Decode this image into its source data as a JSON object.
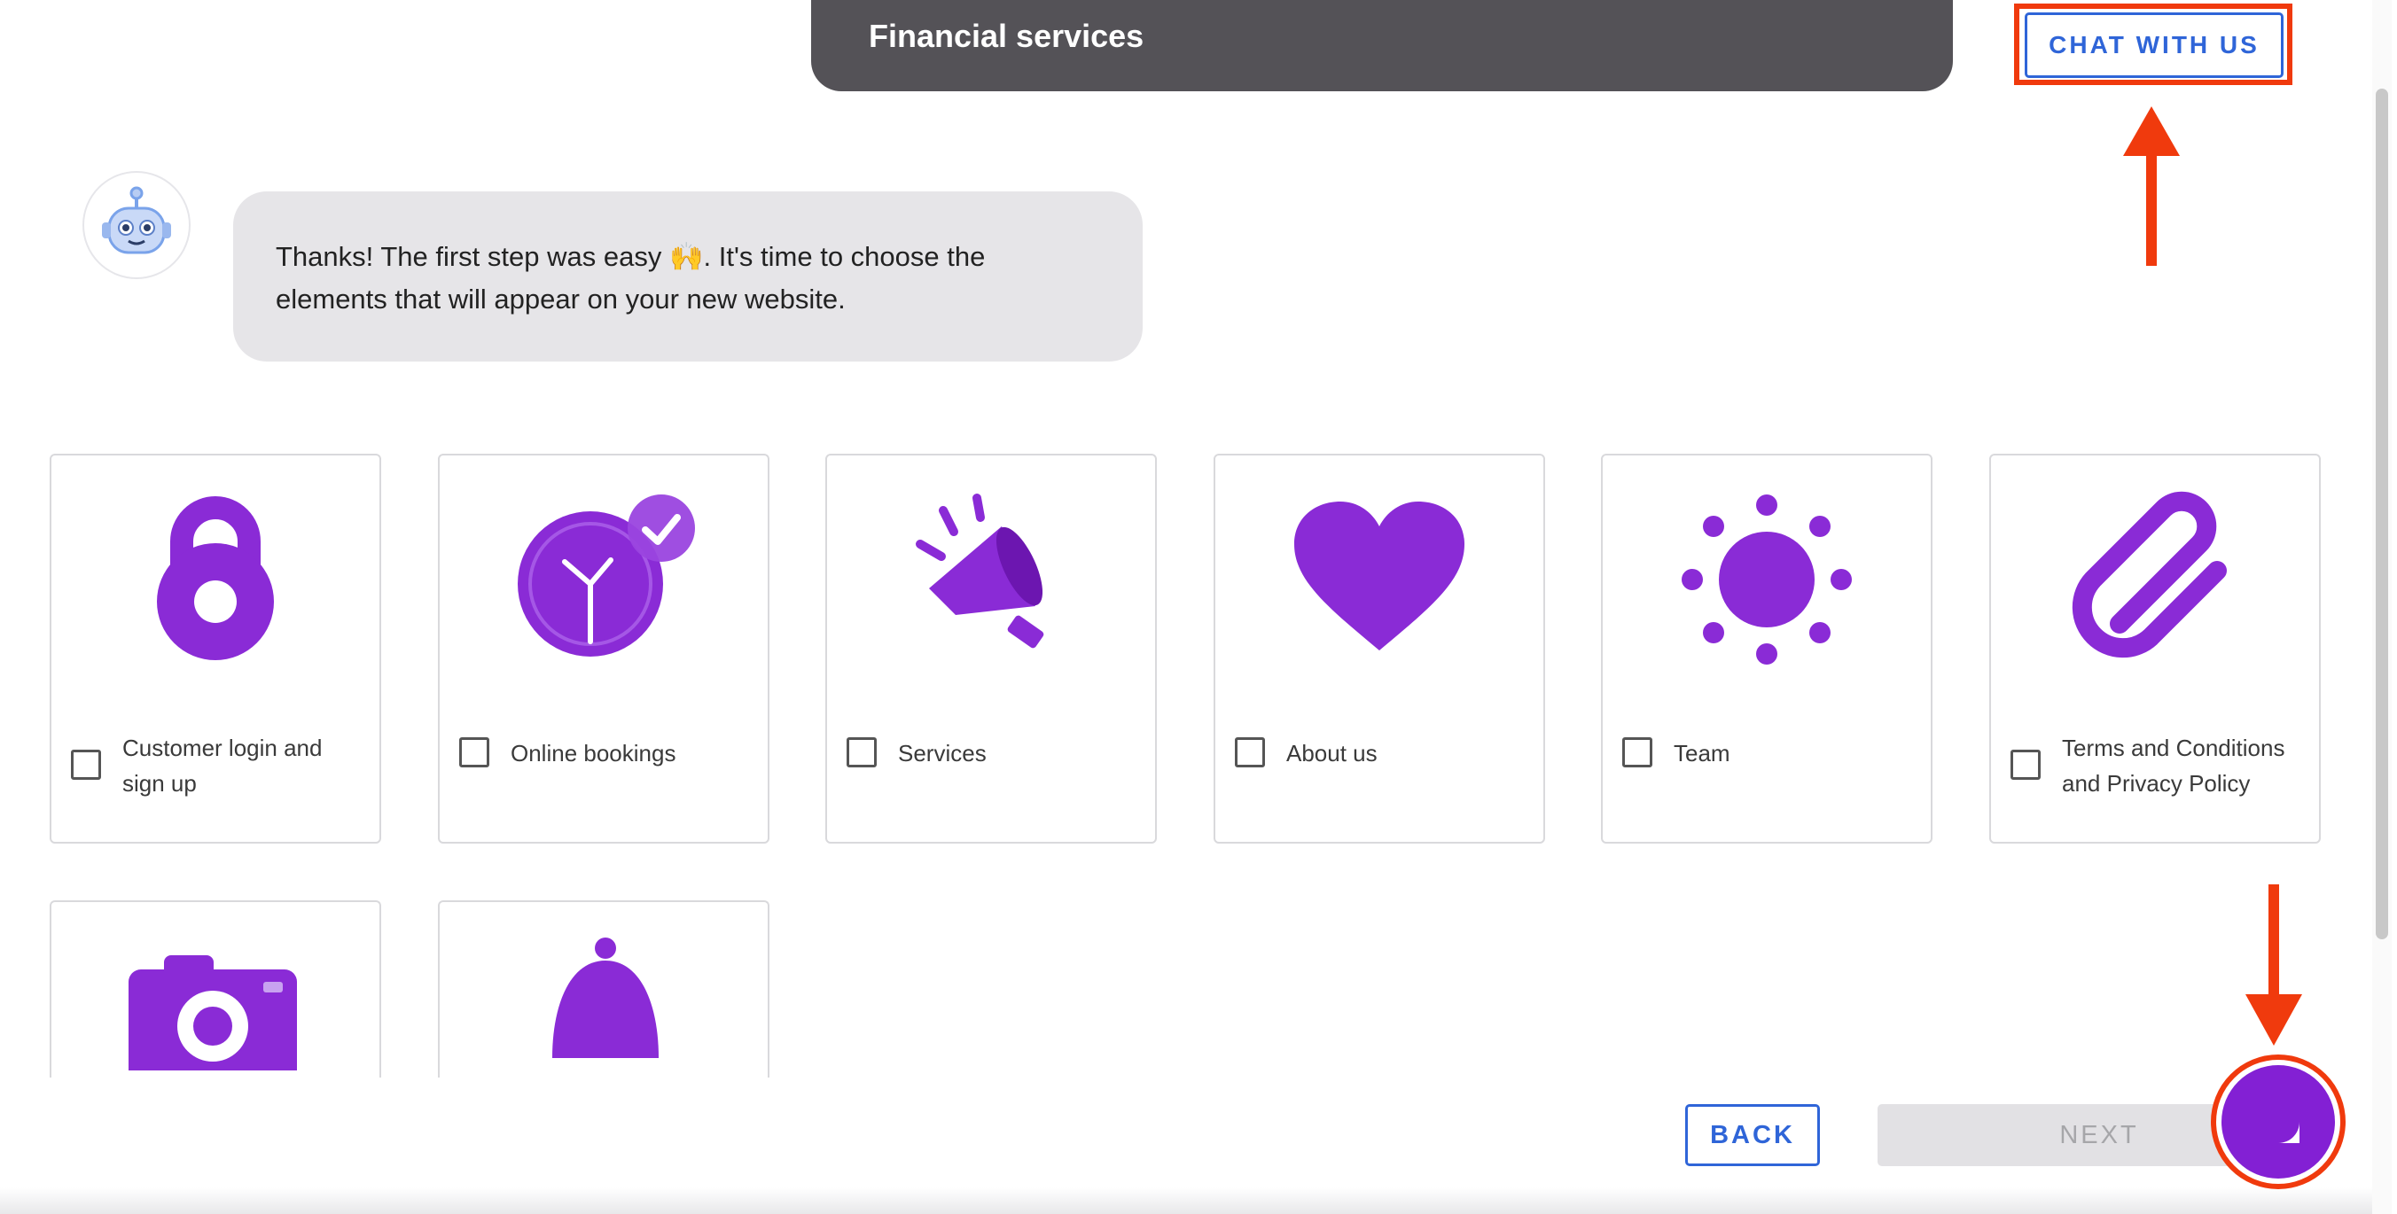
{
  "header": {
    "title": "Financial services"
  },
  "chat_button": {
    "label": "CHAT WITH US"
  },
  "message": {
    "text": "Thanks! The first step was easy 🙌. It's time to choose the elements that will appear on your new website."
  },
  "options": [
    {
      "label": "Customer login and sign up",
      "icon": "lock-icon",
      "checked": false
    },
    {
      "label": "Online bookings",
      "icon": "clock-check-icon",
      "checked": false
    },
    {
      "label": "Services",
      "icon": "megaphone-icon",
      "checked": false
    },
    {
      "label": "About us",
      "icon": "heart-icon",
      "checked": false
    },
    {
      "label": "Team",
      "icon": "sun-icon",
      "checked": false
    },
    {
      "label": "Terms and Conditions and Privacy Policy",
      "icon": "paperclip-icon",
      "checked": false
    }
  ],
  "partial_options": [
    {
      "icon": "camera-icon"
    },
    {
      "icon": "bell-icon"
    }
  ],
  "footer": {
    "back_label": "BACK",
    "next_label": "NEXT"
  },
  "colors": {
    "accent": "#8320d4",
    "link_blue": "#2f65d8",
    "highlight": "#f03a0d",
    "header_bg": "#545257"
  }
}
